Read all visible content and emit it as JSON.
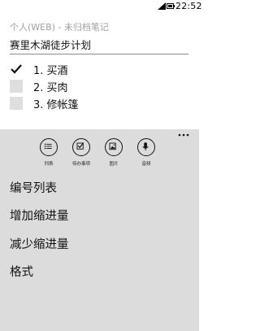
{
  "status_bar": {
    "time": "22:52",
    "signal_icon": "signal-bars-icon",
    "battery_icon": "battery-icon"
  },
  "header": {
    "title": "个人(WEB) - 未归档笔记"
  },
  "note": {
    "title": "赛里木湖徒步计划",
    "checklist": [
      {
        "label": "1. 买酒",
        "checked": true
      },
      {
        "label": "2. 买肉",
        "checked": false
      },
      {
        "label": "3. 修帐篷",
        "checked": false
      }
    ]
  },
  "app_bar": {
    "buttons": [
      {
        "label": "列表",
        "icon": "list-icon"
      },
      {
        "label": "待办事项",
        "icon": "checkbox-icon"
      },
      {
        "label": "图片",
        "icon": "image-icon"
      },
      {
        "label": "音频",
        "icon": "microphone-icon"
      }
    ],
    "menu_items": [
      {
        "label": "编号列表"
      },
      {
        "label": "增加缩进量"
      },
      {
        "label": "减少缩进量"
      },
      {
        "label": "格式"
      }
    ],
    "more_icon": "more-dots-icon"
  }
}
